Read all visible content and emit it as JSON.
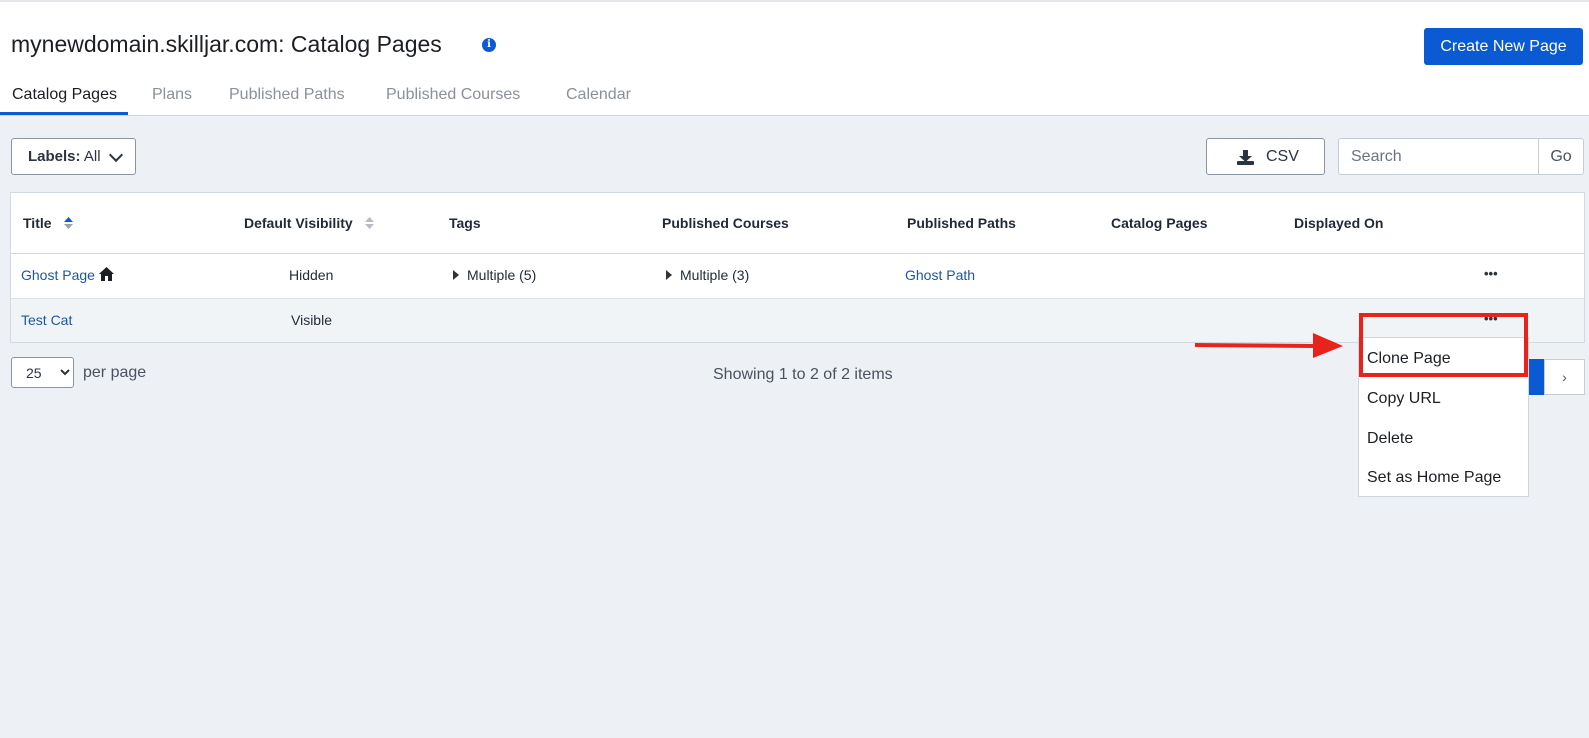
{
  "header": {
    "title": "mynewdomain.skilljar.com: Catalog Pages",
    "info_icon": "info-icon",
    "create_button": "Create New Page"
  },
  "tabs": [
    {
      "label": "Catalog Pages",
      "active": true
    },
    {
      "label": "Plans"
    },
    {
      "label": "Published Paths"
    },
    {
      "label": "Published Courses"
    },
    {
      "label": "Calendar"
    }
  ],
  "toolbar": {
    "labels_key": "Labels:",
    "labels_value": "All",
    "csv_label": "CSV",
    "search_placeholder": "Search",
    "go_label": "Go"
  },
  "table": {
    "columns": [
      "Title",
      "Default Visibility",
      "Tags",
      "Published Courses",
      "Published Paths",
      "Catalog Pages",
      "Displayed On"
    ],
    "rows": [
      {
        "title": "Ghost Page",
        "home_icon": "home-icon",
        "visibility": "Hidden",
        "tags": "Multiple (5)",
        "courses": "Multiple (3)",
        "paths": "Ghost Path",
        "catalog_pages": "",
        "displayed_on": ""
      },
      {
        "title": "Test Cat",
        "visibility": "Visible",
        "tags": "",
        "courses": "",
        "paths": "",
        "catalog_pages": "",
        "displayed_on": ""
      }
    ]
  },
  "pagination": {
    "per_page_value": "25",
    "per_page_label": "per page",
    "showing": "Showing 1 to 2 of 2 items",
    "next": "›"
  },
  "dropdown_menu": {
    "items": [
      "Clone Page",
      "Copy URL",
      "Delete",
      "Set as Home Page"
    ]
  },
  "colors": {
    "accent": "#0a5bd3",
    "annotation": "#e8231c"
  }
}
